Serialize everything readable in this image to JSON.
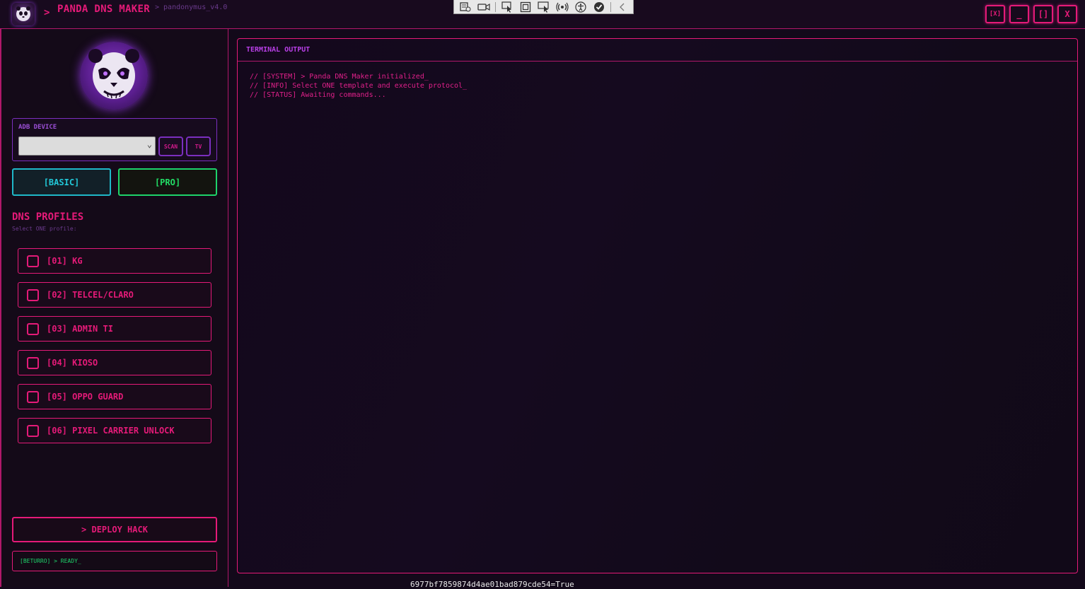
{
  "app": {
    "prompt": ">",
    "title": "PANDA DNS MAKER",
    "version": "> pandonymus_v4.0"
  },
  "window_controls": {
    "restore_x": "[X]",
    "minimize": "_",
    "maximize": "[]",
    "close": "X"
  },
  "overlay_toolbar": {
    "icons": [
      "select-region-icon",
      "record-video-icon",
      "cursor-select-icon",
      "window-capture-icon",
      "screen-pointer-icon",
      "signal-icon",
      "accessibility-icon",
      "checkmark-icon",
      "collapse-chevron-icon"
    ]
  },
  "adb": {
    "label": "ADB DEVICE",
    "selected_device": "",
    "scan_label": "SCAN",
    "tv_label": "TV"
  },
  "modes": {
    "basic": "[BASIC]",
    "pro": "[PRO]"
  },
  "profiles": {
    "title": "DNS PROFILES",
    "subtitle": "Select ONE profile:",
    "items": [
      {
        "label": "[01] KG",
        "checked": false
      },
      {
        "label": "[02] TELCEL/CLARO",
        "checked": false
      },
      {
        "label": "[03] ADMIN TI",
        "checked": false
      },
      {
        "label": "[04] KIOSO",
        "checked": false
      },
      {
        "label": "[05] OPPO GUARD",
        "checked": false
      },
      {
        "label": "[06] PIXEL CARRIER UNLOCK",
        "checked": false
      }
    ]
  },
  "deploy": {
    "label": "> DEPLOY HACK"
  },
  "status": {
    "text": "[BETURRO] > READY_"
  },
  "terminal": {
    "title": "TERMINAL OUTPUT",
    "lines": [
      "// [SYSTEM] > Panda DNS Maker initialized_",
      "// [INFO] Select ONE template and execute protocol_",
      "// [STATUS] Awaiting commands..."
    ]
  },
  "background_text": "6977bf7859874d4ae01bad879cde54=True",
  "colors": {
    "accent_pink": "#e51a78",
    "accent_purple": "#7b2fbf",
    "cyan": "#22c8d8",
    "green": "#22dd66",
    "background": "#13091a"
  }
}
